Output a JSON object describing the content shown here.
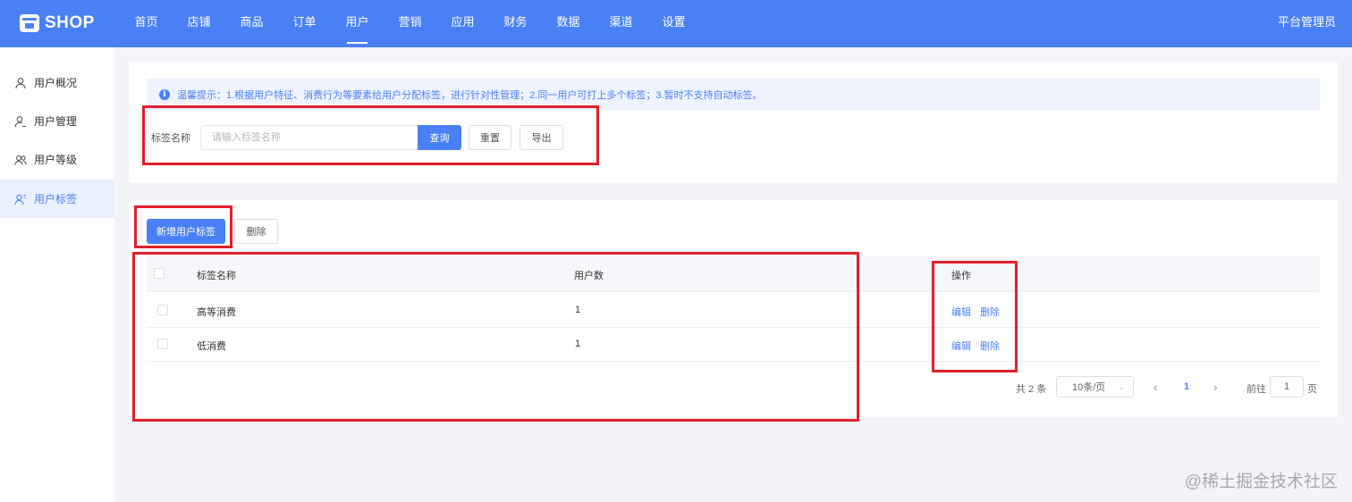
{
  "brand": {
    "name": "SHOP"
  },
  "nav": {
    "items": [
      "首页",
      "店铺",
      "商品",
      "订单",
      "用户",
      "营销",
      "应用",
      "财务",
      "数据",
      "渠道",
      "设置"
    ],
    "active": "用户",
    "admin_label": "平台管理员"
  },
  "sidebar": {
    "items": [
      {
        "label": "用户概况",
        "icon": "user-icon"
      },
      {
        "label": "用户管理",
        "icon": "user-manage-icon"
      },
      {
        "label": "用户等级",
        "icon": "user-group-icon"
      },
      {
        "label": "用户标签",
        "icon": "user-tag-icon"
      }
    ],
    "active": "用户标签"
  },
  "tip": {
    "text": "温馨提示：1.根据用户特征、消费行为等要素给用户分配标签，进行针对性管理；2.同一用户可打上多个标签；3.暂时不支持自动标签。"
  },
  "filter": {
    "label": "标签名称",
    "placeholder": "请输入标签名称",
    "value": "",
    "query_label": "查询",
    "reset_label": "重置",
    "export_label": "导出"
  },
  "actions": {
    "add_label": "新增用户标签",
    "delete_label": "删除"
  },
  "table": {
    "columns": [
      "标签名称",
      "用户数",
      "操作"
    ],
    "rows": [
      {
        "name": "高等消费",
        "count": "1",
        "edit": "编辑",
        "delete": "删除"
      },
      {
        "name": "低消费",
        "count": "1",
        "edit": "编辑",
        "delete": "删除"
      }
    ]
  },
  "pagination": {
    "total_text": "共 2 条",
    "page_size": "10条/页",
    "current_page": "1",
    "goto_label": "前往",
    "goto_value": "1",
    "page_unit": "页"
  },
  "watermark": "@稀土掘金技术社区",
  "colors": {
    "primary": "#4a80f5",
    "highlight": "#e0202b"
  }
}
